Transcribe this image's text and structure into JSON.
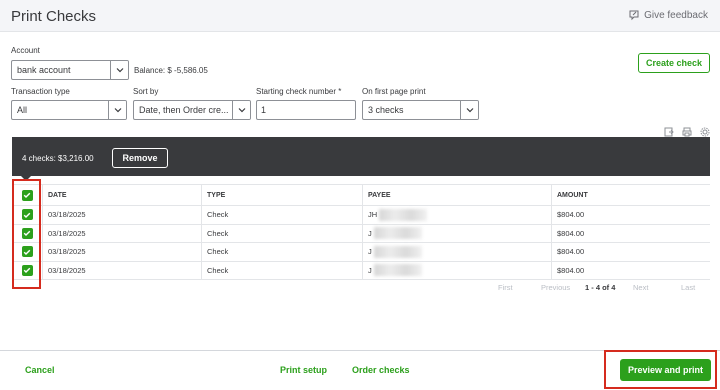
{
  "header": {
    "title": "Print Checks",
    "feedback_label": "Give feedback"
  },
  "form": {
    "account": {
      "label": "Account",
      "value": "bank account",
      "balance": "Balance: $ -5,586.05"
    },
    "transaction_type": {
      "label": "Transaction type",
      "value": "All"
    },
    "sort_by": {
      "label": "Sort by",
      "value": "Date, then Order cre..."
    },
    "starting_check_number": {
      "label": "Starting check number *",
      "value": "1"
    },
    "on_first_page_print": {
      "label": "On first page print",
      "value": "3 checks"
    },
    "create_check_label": "Create check"
  },
  "selection": {
    "summary": "4 checks: $3,216.00",
    "remove_label": "Remove"
  },
  "table": {
    "headers": [
      "DATE",
      "TYPE",
      "PAYEE",
      "AMOUNT"
    ],
    "rows": [
      {
        "date": "03/18/2025",
        "type": "Check",
        "payee": "JH",
        "amount": "$804.00"
      },
      {
        "date": "03/18/2025",
        "type": "Check",
        "payee": "J",
        "amount": "$804.00"
      },
      {
        "date": "03/18/2025",
        "type": "Check",
        "payee": "J",
        "amount": "$804.00"
      },
      {
        "date": "03/18/2025",
        "type": "Check",
        "payee": "J",
        "amount": "$804.00"
      }
    ]
  },
  "pagination": {
    "first": "First",
    "previous": "Previous",
    "range": "1 - 4 of 4",
    "next": "Next",
    "last": "Last"
  },
  "footer": {
    "cancel": "Cancel",
    "print_setup": "Print setup",
    "order_checks": "Order checks",
    "preview_and_print": "Preview and print"
  },
  "colors": {
    "accent": "#2ca01c",
    "dark_bar": "#393a3d",
    "highlight": "#d52b1e"
  }
}
